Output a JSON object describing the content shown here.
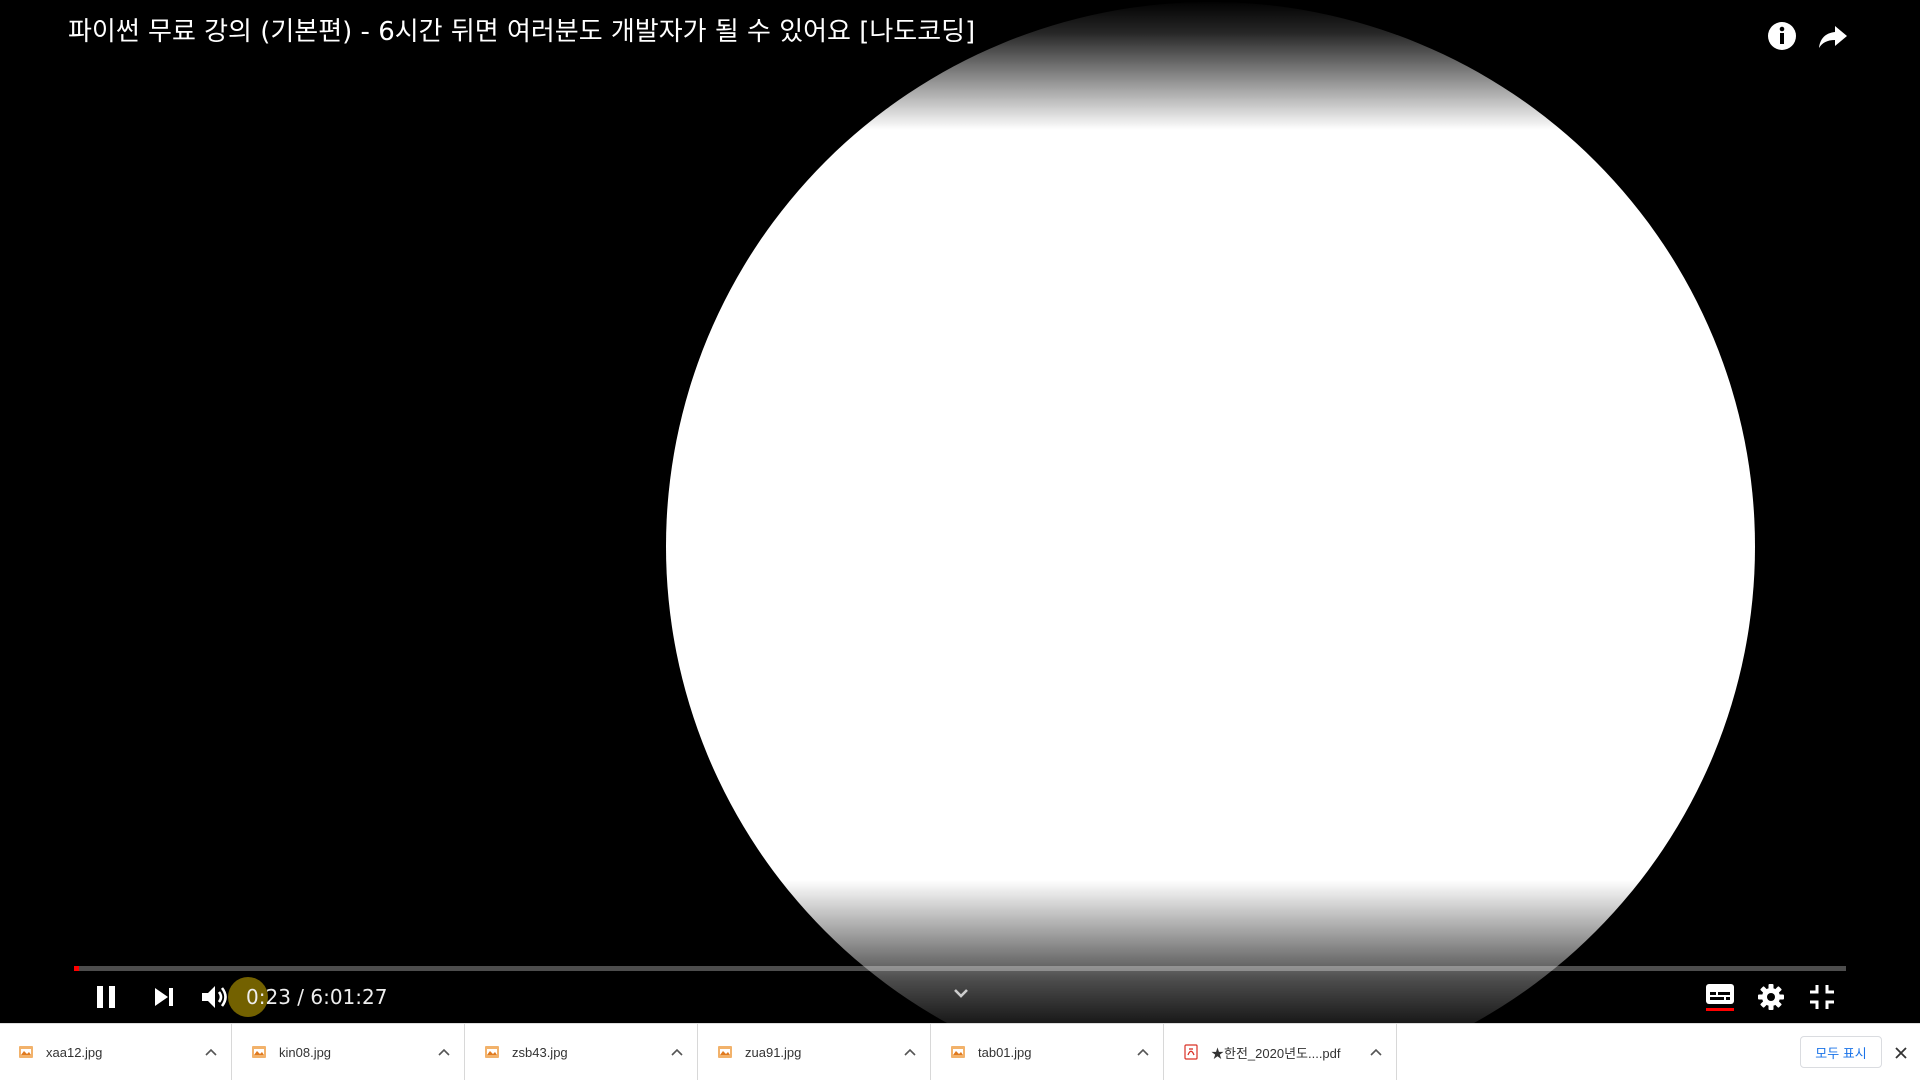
{
  "player": {
    "title": "파이썬 무료 강의 (기본편) - 6시간 뒤면 여러분도 개발자가 될 수 있어요 [나도코딩]",
    "time_display": "0:23 / 6:01:27",
    "progress_fraction": 0.0011,
    "controls": {
      "play_pause_icon": "pause-icon",
      "next_icon": "skip-next-icon",
      "volume_icon": "volume-icon",
      "subtitles_icon": "subtitles-icon",
      "settings_icon": "gear-icon",
      "fullscreen_icon": "exit-fullscreen-icon"
    },
    "top_icons": [
      "info-icon",
      "share-icon"
    ],
    "accent_color": "#ff0000"
  },
  "downloads": {
    "items": [
      {
        "name": "xaa12.jpg",
        "icon": "image-file-icon"
      },
      {
        "name": "kin08.jpg",
        "icon": "image-file-icon"
      },
      {
        "name": "zsb43.jpg",
        "icon": "image-file-icon"
      },
      {
        "name": "zua91.jpg",
        "icon": "image-file-icon"
      },
      {
        "name": "tab01.jpg",
        "icon": "image-file-icon"
      },
      {
        "name": "★한전_2020년도....pdf",
        "icon": "pdf-file-icon"
      }
    ],
    "show_all_label": "모두 표시",
    "close_icon": "close-icon"
  }
}
